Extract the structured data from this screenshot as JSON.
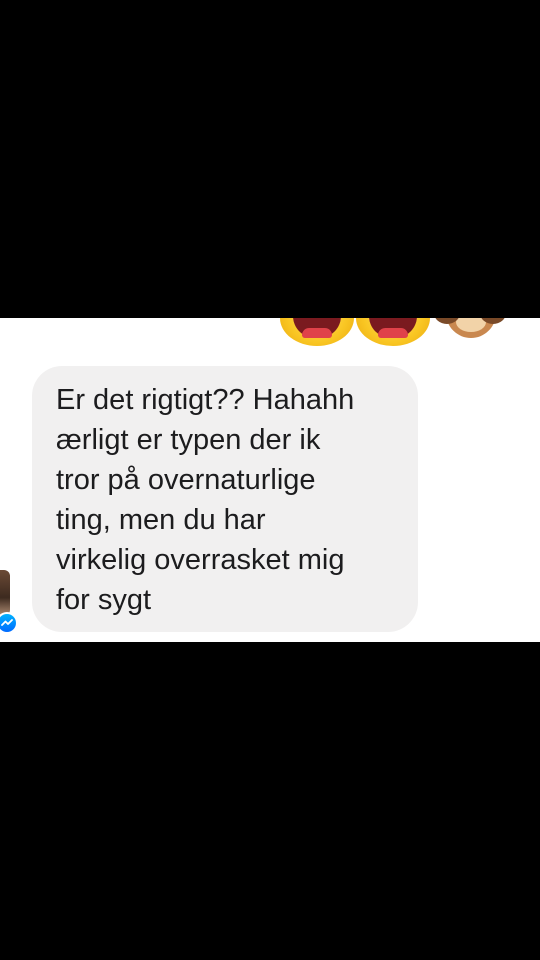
{
  "conversation": {
    "message": {
      "text": "Er det rigtigt?? Hahahh\nærligt er typen der ik\ntror på overnaturlige\nting, men du har\nvirkelig overrasket mig\nfor sygt"
    },
    "reactions": [
      {
        "icon": "face-with-tears-of-joy-icon"
      },
      {
        "icon": "face-with-tears-of-joy-icon"
      },
      {
        "icon": "see-no-evil-monkey-icon"
      }
    ],
    "avatar_badge": {
      "icon": "messenger-icon"
    }
  },
  "colors": {
    "letterbox": "#000000",
    "background": "#ffffff",
    "bubble": "#f1f0f0",
    "text": "#1c1c1e",
    "messenger_blue": "#0084ff"
  }
}
